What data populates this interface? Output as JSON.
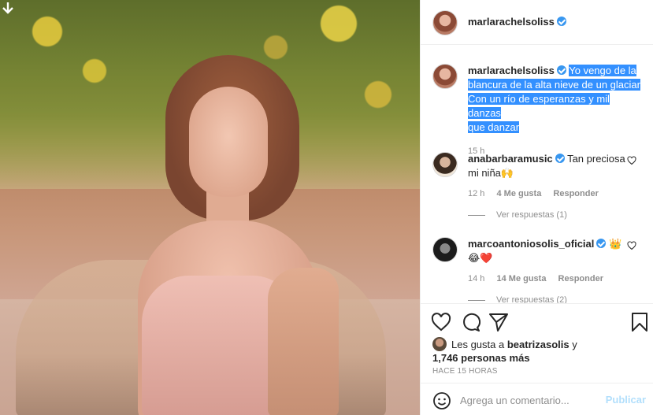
{
  "post": {
    "author": "marlarachelsoliss",
    "caption_lines": [
      "Yo vengo de la",
      "blancura de la alta nieve de un glaciar",
      "Con un río de esperanzas y mil danzas",
      "que danzar"
    ],
    "caption_time": "15 h"
  },
  "comments": [
    {
      "user": "anabarbaramusic",
      "text": "Tan preciosa",
      "text2": "mi niña🙌",
      "time": "12 h",
      "likes": "4 Me gusta",
      "reply": "Responder",
      "view_replies": "Ver respuestas (1)"
    },
    {
      "user": "marcoantoniosolis_oficial",
      "text": "👑",
      "text2": "😂❤️",
      "time": "14 h",
      "likes": "14 Me gusta",
      "reply": "Responder",
      "view_replies": "Ver respuestas (2)"
    }
  ],
  "likes": {
    "prefix": "Les gusta a",
    "user": "beatrizasolis",
    "conj": "y",
    "count": "1,746 personas más"
  },
  "timestamp": "HACE 15 HORAS",
  "add_comment": {
    "placeholder": "Agrega un comentario...",
    "publish": "Publicar"
  },
  "icons": [
    "download-icon",
    "heart-icon",
    "comment-icon",
    "share-icon",
    "save-icon",
    "emoji-icon",
    "verified-icon"
  ]
}
